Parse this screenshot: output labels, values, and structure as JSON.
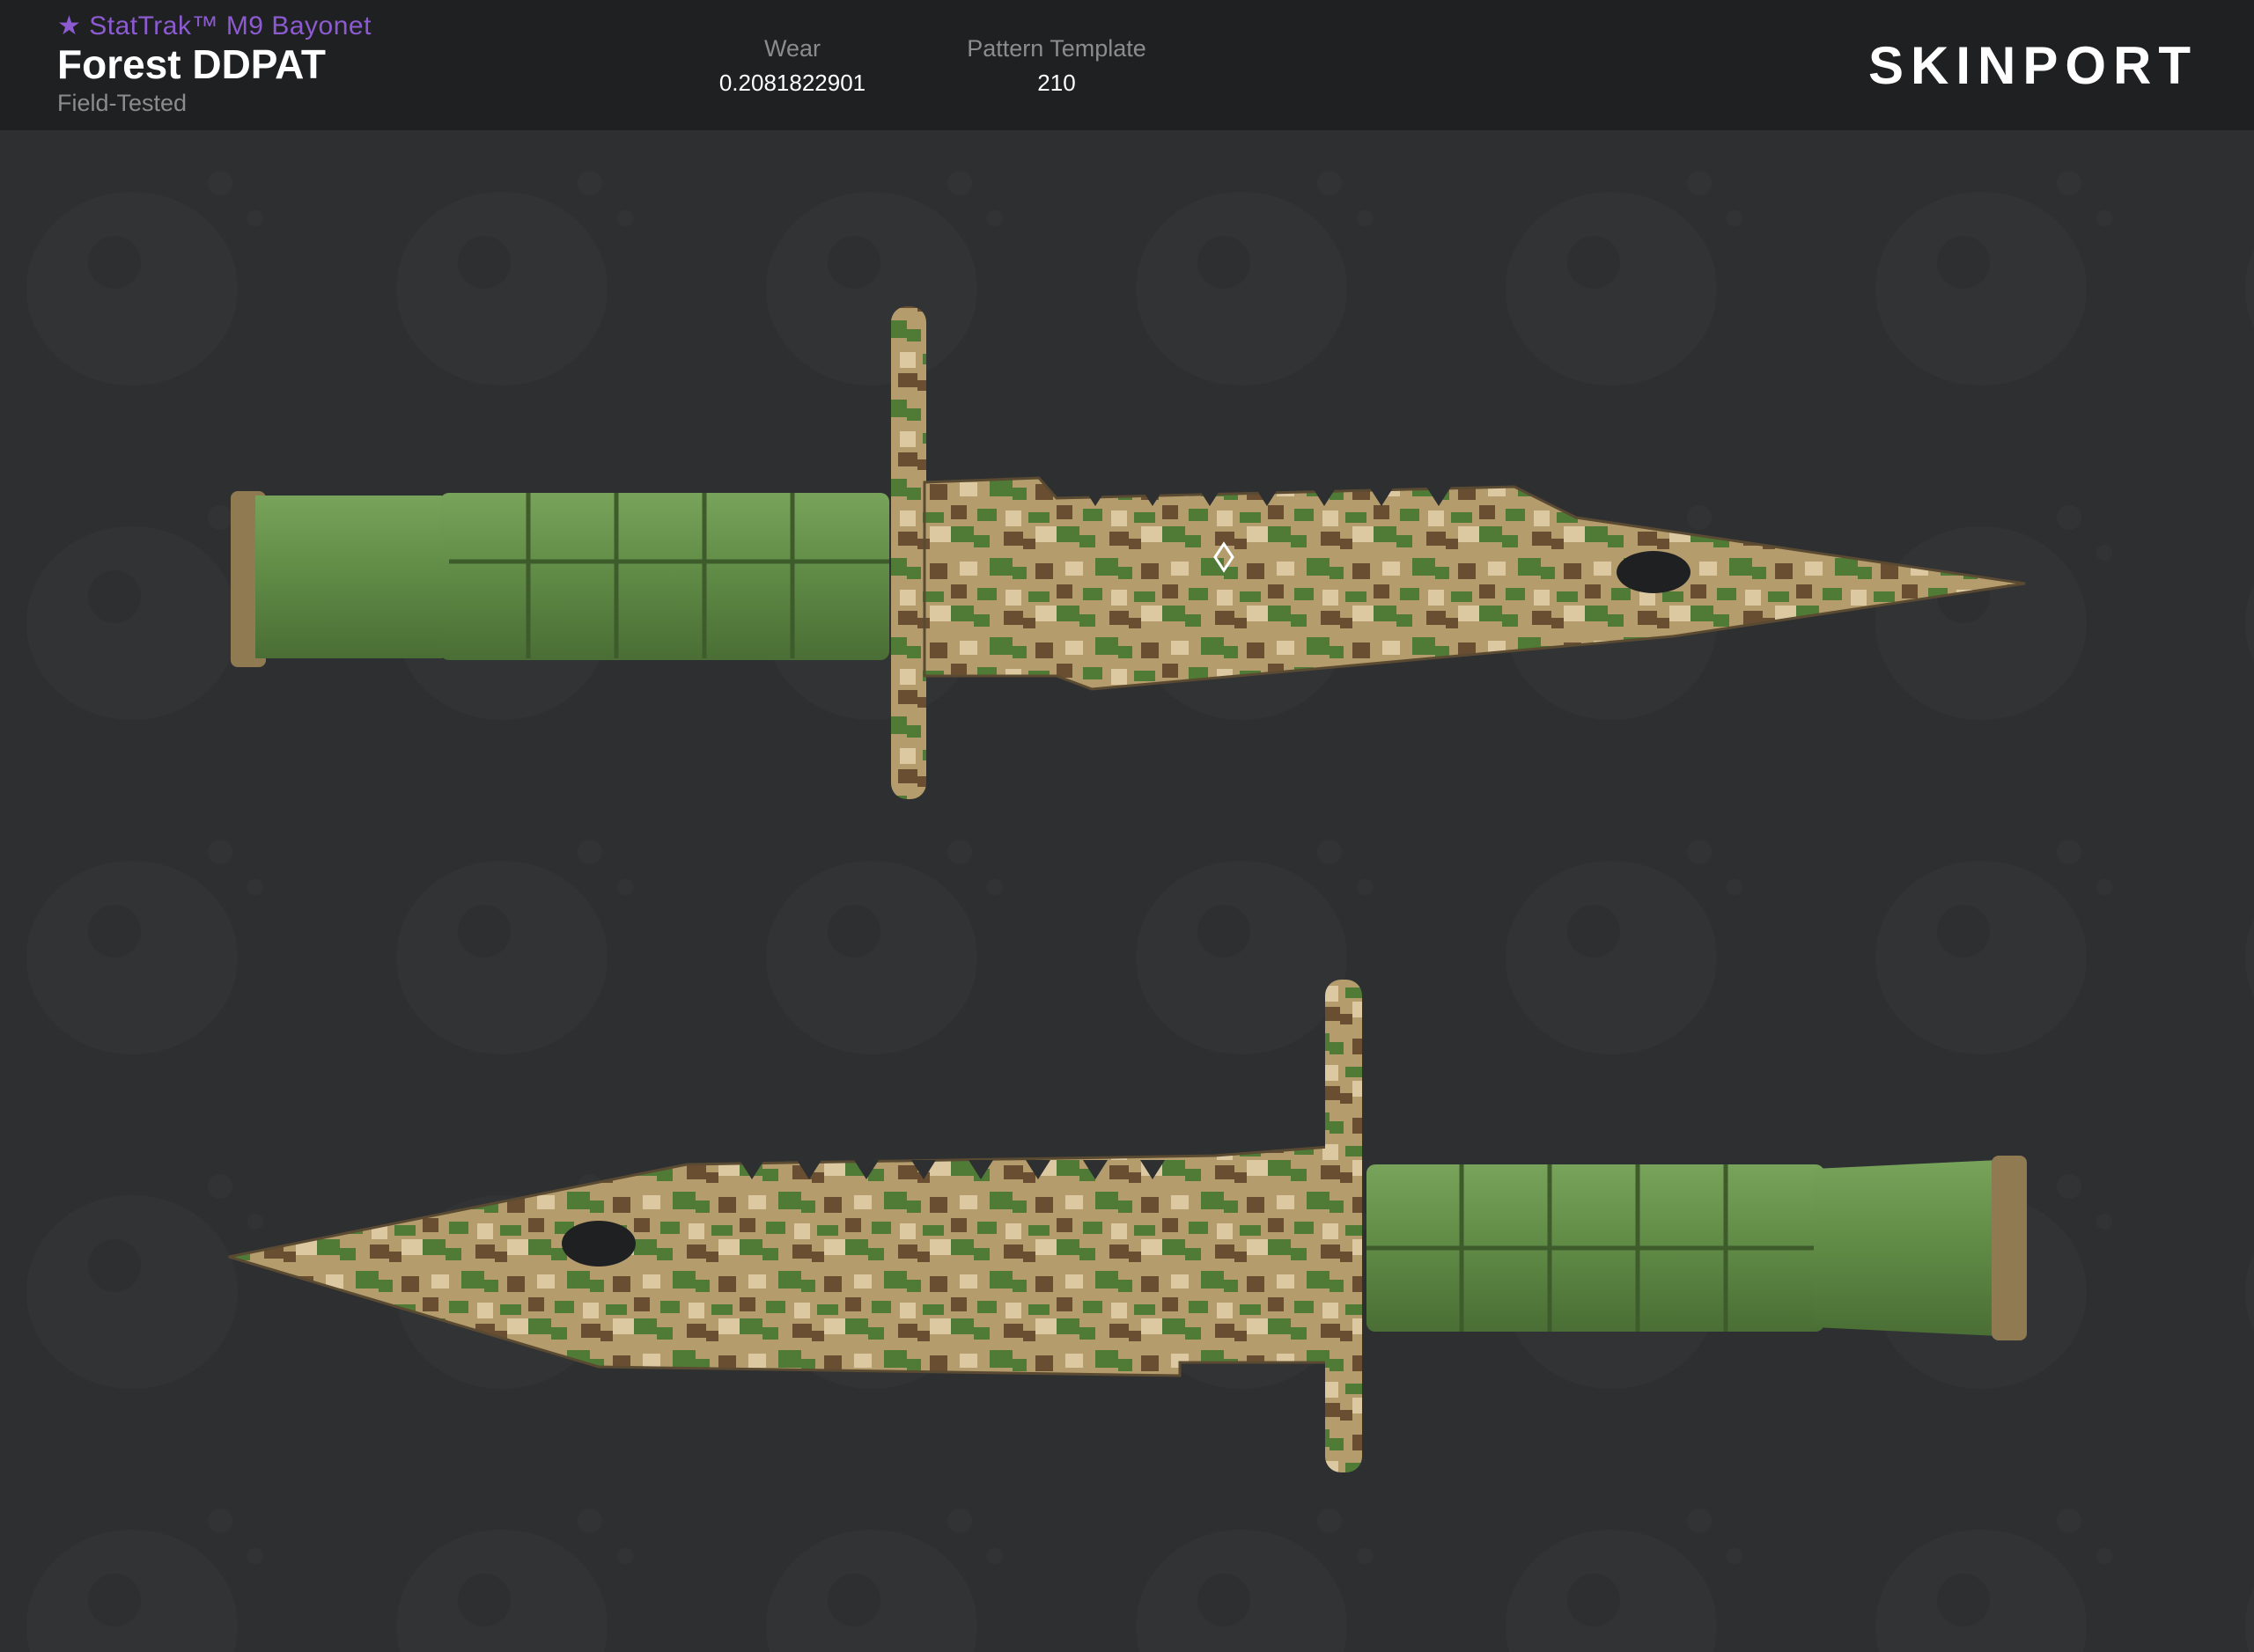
{
  "item": {
    "type_label": "★ StatTrak™ M9 Bayonet",
    "name": "Forest DDPAT",
    "exterior": "Field-Tested"
  },
  "stats": {
    "wear_label": "Wear",
    "wear_value": "0.2081822901",
    "pattern_label": "Pattern Template",
    "pattern_value": "210"
  },
  "brand": {
    "logo_text": "SKINPORT",
    "accent_color": "#e3283c"
  },
  "colors": {
    "header_bg": "#1f2022",
    "page_bg": "#2d2f31",
    "type_purple": "#8c5bd0",
    "handle_green": "#5f8a45",
    "camo_tan": "#b49c6c",
    "camo_green": "#4f7b36",
    "camo_brown": "#6a4e32",
    "camo_light": "#dcc9a2"
  },
  "images": {
    "knife_top": "m9-bayonet-forest-ddpat-side-a",
    "knife_bottom": "m9-bayonet-forest-ddpat-side-b"
  }
}
